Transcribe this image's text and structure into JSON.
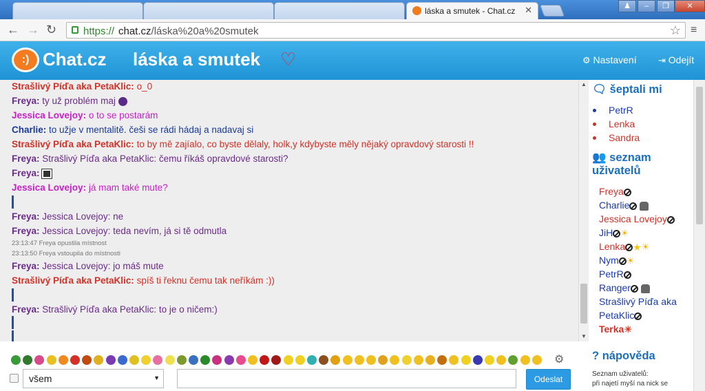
{
  "browser": {
    "active_tab_title": "láska a smutek - Chat.cz",
    "url_scheme": "https://",
    "url_host": "chat.cz",
    "url_path": "/láska%20a%20smutek"
  },
  "header": {
    "logo_glyph": ":)",
    "logo_text": "Chat.cz",
    "room_title": "láska a smutek",
    "heart_glyph": "♡",
    "settings_label": "Nastavení",
    "logout_label": "Odejít"
  },
  "messages": [
    {
      "nick": "Strašlivý Píďa aka PetaKlic:",
      "text": "o_0",
      "nick_color": "#d23127",
      "text_color": "#d23127"
    },
    {
      "nick": "Freya:",
      "text": "ty už problém maj",
      "nick_color": "#6a2b8a",
      "text_color": "#6a2b8a",
      "emoticon": "purple-face"
    },
    {
      "nick": "Jessica Lovejoy:",
      "text": "o to se postarám",
      "nick_color": "#c820c8",
      "text_color": "#c820c8"
    },
    {
      "nick": "Charlie:",
      "text": "to užje v mentalitě. češi se rádi hádaj a nadavaj si",
      "nick_color": "#1a3a9a",
      "text_color": "#1a3a9a"
    },
    {
      "nick": "Strašlivý Píďa aka PetaKlic:",
      "text": "to by mě zajíalo, co byste dělaly, holk,y kdybyste měly nějaký opravdový starosti !!",
      "nick_color": "#d23127",
      "text_color": "#d23127"
    },
    {
      "nick": "Freya:",
      "text": "Strašlivý Píďa aka PetaKlic: čemu říkáš opravdové starosti?",
      "nick_color": "#6a2b8a",
      "text_color": "#6a2b8a"
    },
    {
      "nick": "Freya:",
      "text": "",
      "nick_color": "#6a2b8a",
      "text_color": "#6a2b8a",
      "emoticon": "cow"
    },
    {
      "nick": "Jessica Lovejoy:",
      "text": "já mam také mute?",
      "nick_color": "#c820c8",
      "text_color": "#c820c8"
    },
    {
      "nick": "Freya:",
      "text": "Jessica Lovejoy: ne",
      "nick_color": "#6a2b8a",
      "text_color": "#6a2b8a"
    },
    {
      "nick": "Freya:",
      "text": "Jessica Lovejoy: teda nevím, já si tě odmutla",
      "nick_color": "#6a2b8a",
      "text_color": "#6a2b8a"
    },
    {
      "nick": "Freya:",
      "text": "Jessica Lovejoy: jo máš mute",
      "nick_color": "#6a2b8a",
      "text_color": "#6a2b8a"
    },
    {
      "nick": "Strašlivý Píďa aka PetaKlic:",
      "text": "spíš ti řeknu čemu tak neříkám :))",
      "nick_color": "#d23127",
      "text_color": "#d23127"
    },
    {
      "nick": "Freya:",
      "text": "Strašlivý Píďa aka PetaKlic: to je o ničem:)",
      "nick_color": "#6a2b8a",
      "text_color": "#6a2b8a"
    }
  ],
  "system_messages": [
    "23:13:47 Freya opustila místnost",
    "23:13:50 Freya vstoupila do místnosti"
  ],
  "sidebar": {
    "whisper_heading": "šeptali mi",
    "whispers": [
      {
        "name": "PetrR",
        "color": "#1a3ab0"
      },
      {
        "name": "Lenka",
        "color": "#d23127"
      },
      {
        "name": "Sandra",
        "color": "#d23127"
      }
    ],
    "users_heading": "seznam uživatelů",
    "users": [
      {
        "name": "Freya",
        "color": "#d23127",
        "badges": [
          "blocked"
        ]
      },
      {
        "name": "Charlie",
        "color": "#1a3ab0",
        "badges": [
          "blocked",
          "spy"
        ]
      },
      {
        "name": "Jessica Lovejoy",
        "color": "#d23127",
        "badges": [
          "blocked"
        ]
      },
      {
        "name": "JiH",
        "color": "#1a3ab0",
        "badges": [
          "blocked",
          "sun"
        ]
      },
      {
        "name": "Lenka",
        "color": "#d23127",
        "badges": [
          "blocked",
          "star",
          "sun"
        ]
      },
      {
        "name": "Nym",
        "color": "#1a3ab0",
        "badges": [
          "blocked",
          "sun"
        ]
      },
      {
        "name": "PetrR",
        "color": "#1a3ab0",
        "badges": [
          "blocked"
        ]
      },
      {
        "name": "Ranger",
        "color": "#1a3ab0",
        "badges": [
          "blocked",
          "spy"
        ]
      },
      {
        "name": "Strašlivý Píďa aka",
        "color": "#1a3ab0",
        "badges": []
      },
      {
        "name": "PetaKlic",
        "color": "#1a3ab0",
        "badges": [
          "blocked"
        ]
      },
      {
        "name": "Terka",
        "color": "#d23127",
        "badges": [
          "sun-red"
        ],
        "bold": true
      }
    ],
    "help_heading": "nápověda",
    "help_line1": "Seznam uživatelů:",
    "help_line2": "při najetí myší na nick se"
  },
  "input": {
    "recipient_value": "všem",
    "message_placeholder": "",
    "send_label": "Odeslat"
  },
  "colors": {
    "header_blue": "#1f93d6",
    "logo_orange": "#f37c20",
    "accent_red": "#d23127",
    "send_blue": "#2d9be3"
  }
}
